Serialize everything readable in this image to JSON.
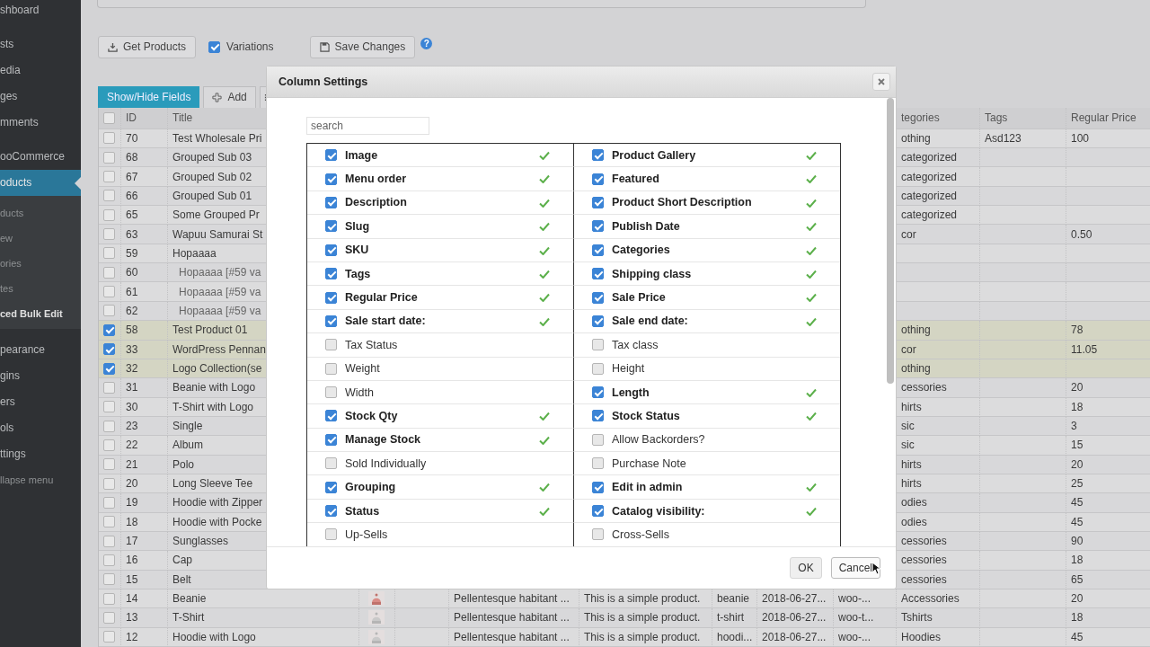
{
  "sidebar": {
    "groups": [
      {
        "items": [
          {
            "label": "shboard",
            "selected": false
          }
        ]
      },
      {
        "items": [
          {
            "label": "sts",
            "selected": false
          },
          {
            "label": "edia",
            "selected": false
          },
          {
            "label": "ges",
            "selected": false
          },
          {
            "label": "mments",
            "selected": false
          }
        ]
      },
      {
        "items": [
          {
            "label": "ooCommerce",
            "selected": false
          },
          {
            "label": "oducts",
            "selected": true,
            "children": [
              {
                "label": "ducts",
                "selected": false
              },
              {
                "label": "ew",
                "selected": false
              },
              {
                "label": "ories",
                "selected": false
              },
              {
                "label": "tes",
                "selected": false
              },
              {
                "label": "ced Bulk Edit",
                "selected": true
              }
            ]
          }
        ]
      },
      {
        "items": [
          {
            "label": "pearance",
            "selected": false
          },
          {
            "label": "gins",
            "selected": false
          },
          {
            "label": "ers",
            "selected": false
          },
          {
            "label": "ols",
            "selected": false
          },
          {
            "label": "ttings",
            "selected": false
          }
        ]
      }
    ],
    "collapse": "llapse menu"
  },
  "toolbar": {
    "get_products": "Get Products",
    "variations": {
      "label": "Variations",
      "checked": true
    },
    "save_changes": "Save Changes",
    "help": "?"
  },
  "tabs": {
    "show_hide": "Show/Hide Fields",
    "add": "Add"
  },
  "table": {
    "select_all": false,
    "columns": {
      "id": "ID",
      "title": "Title",
      "categories": "tegories",
      "tags": "Tags",
      "price": "Regular Price"
    },
    "rows": [
      {
        "selected": false,
        "kind": "product",
        "id": "70",
        "title": "Test Wholesale Pri",
        "categories": "othing",
        "tags": "Asd123",
        "price": "100"
      },
      {
        "selected": false,
        "kind": "product",
        "id": "68",
        "title": "Grouped Sub 03",
        "categories": "categorized"
      },
      {
        "selected": false,
        "kind": "product",
        "id": "67",
        "title": "Grouped Sub 02",
        "categories": "categorized"
      },
      {
        "selected": false,
        "kind": "product",
        "id": "66",
        "title": "Grouped Sub 01",
        "categories": "categorized"
      },
      {
        "selected": false,
        "kind": "product",
        "id": "65",
        "title": "Some Grouped Pr",
        "categories": "categorized"
      },
      {
        "selected": false,
        "kind": "product",
        "id": "63",
        "title": "Wapuu Samurai St",
        "categories": "cor",
        "price": "0.50"
      },
      {
        "selected": false,
        "kind": "product",
        "id": "59",
        "title": "Hopaaaa"
      },
      {
        "selected": false,
        "kind": "variation",
        "id": "60",
        "title": "Hopaaaa [#59 va"
      },
      {
        "selected": false,
        "kind": "variation",
        "id": "61",
        "title": "Hopaaaa [#59 va"
      },
      {
        "selected": false,
        "kind": "variation",
        "id": "62",
        "title": "Hopaaaa [#59 va"
      },
      {
        "selected": true,
        "kind": "product",
        "id": "58",
        "title": "Test Product 01",
        "categories": "othing",
        "price": "78"
      },
      {
        "selected": true,
        "kind": "product",
        "id": "33",
        "title": "WordPress Pennan",
        "categories": "cor",
        "price": "11.05"
      },
      {
        "selected": true,
        "kind": "product",
        "id": "32",
        "title": "Logo Collection(se",
        "categories": "othing"
      },
      {
        "selected": false,
        "kind": "product",
        "id": "31",
        "title": "Beanie with Logo",
        "categories": "cessories",
        "price": "20"
      },
      {
        "selected": false,
        "kind": "product",
        "id": "30",
        "title": "T-Shirt with Logo",
        "categories": "hirts",
        "price": "18"
      },
      {
        "selected": false,
        "kind": "product",
        "id": "23",
        "title": "Single",
        "categories": "sic",
        "price": "3"
      },
      {
        "selected": false,
        "kind": "product",
        "id": "22",
        "title": "Album",
        "categories": "sic",
        "price": "15"
      },
      {
        "selected": false,
        "kind": "product",
        "id": "21",
        "title": "Polo",
        "categories": "hirts",
        "price": "20"
      },
      {
        "selected": false,
        "kind": "product",
        "id": "20",
        "title": "Long Sleeve Tee",
        "categories": "hirts",
        "price": "25"
      },
      {
        "selected": false,
        "kind": "product",
        "id": "19",
        "title": "Hoodie with Zipper",
        "categories": "odies",
        "price": "45"
      },
      {
        "selected": false,
        "kind": "product",
        "id": "18",
        "title": "Hoodie with Pocke",
        "categories": "odies",
        "price": "45"
      },
      {
        "selected": false,
        "kind": "product",
        "id": "17",
        "title": "Sunglasses",
        "categories": "cessories",
        "price": "90"
      },
      {
        "selected": false,
        "kind": "product",
        "id": "16",
        "title": "Cap",
        "categories": "cessories",
        "price": "18"
      },
      {
        "selected": false,
        "kind": "product",
        "id": "15",
        "title": "Belt",
        "categories": "cessories",
        "price": "65"
      },
      {
        "selected": false,
        "kind": "product",
        "id": "14",
        "title": "Beanie",
        "description": "Pellentesque habitant ...",
        "short_description": "This is a simple product.",
        "slug": "beanie",
        "date": "2018-06-27...",
        "sku": "woo-...",
        "categories": "Accessories",
        "price": "20"
      },
      {
        "selected": false,
        "kind": "product",
        "id": "13",
        "title": "T-Shirt",
        "description": "Pellentesque habitant ...",
        "short_description": "This is a simple product.",
        "slug": "t-shirt",
        "date": "2018-06-27...",
        "sku": "woo-t...",
        "categories": "Tshirts",
        "price": "18"
      },
      {
        "selected": false,
        "kind": "product",
        "id": "12",
        "title": "Hoodie with Logo",
        "description": "Pellentesque habitant ...",
        "short_description": "This is a simple product.",
        "slug": "hoodi...",
        "date": "2018-06-27...",
        "sku": "woo-...",
        "categories": "Hoodies",
        "price": "45"
      }
    ]
  },
  "modal": {
    "title": "Column Settings",
    "search": {
      "placeholder": "search"
    },
    "fields": [
      {
        "label": "Image",
        "checked": true
      },
      {
        "label": "Product Gallery",
        "checked": true
      },
      {
        "label": "Menu order",
        "checked": true
      },
      {
        "label": "Featured",
        "checked": true
      },
      {
        "label": "Description",
        "checked": true
      },
      {
        "label": "Product Short Description",
        "checked": true
      },
      {
        "label": "Slug",
        "checked": true
      },
      {
        "label": "Publish Date",
        "checked": true
      },
      {
        "label": "SKU",
        "checked": true
      },
      {
        "label": "Categories",
        "checked": true
      },
      {
        "label": "Tags",
        "checked": true
      },
      {
        "label": "Shipping class",
        "checked": true
      },
      {
        "label": "Regular Price",
        "checked": true
      },
      {
        "label": "Sale Price",
        "checked": true
      },
      {
        "label": "Sale start date:",
        "checked": true
      },
      {
        "label": "Sale end date:",
        "checked": true
      },
      {
        "label": "Tax Status",
        "checked": false
      },
      {
        "label": "Tax class",
        "checked": false
      },
      {
        "label": "Weight",
        "checked": false
      },
      {
        "label": "Height",
        "checked": false
      },
      {
        "label": "Width",
        "checked": false
      },
      {
        "label": "Length",
        "checked": true
      },
      {
        "label": "Stock Qty",
        "checked": true
      },
      {
        "label": "Stock Status",
        "checked": true
      },
      {
        "label": "Manage Stock",
        "checked": true
      },
      {
        "label": "Allow Backorders?",
        "checked": false
      },
      {
        "label": "Sold Individually",
        "checked": false
      },
      {
        "label": "Purchase Note",
        "checked": false
      },
      {
        "label": "Grouping",
        "checked": true
      },
      {
        "label": "Edit in admin",
        "checked": true
      },
      {
        "label": "Status",
        "checked": true
      },
      {
        "label": "Catalog visibility:",
        "checked": true
      },
      {
        "label": "Up-Sells",
        "checked": false
      },
      {
        "label": "Cross-Sells",
        "checked": false
      }
    ],
    "buttons": {
      "ok": "OK",
      "cancel": "Cancel"
    }
  }
}
